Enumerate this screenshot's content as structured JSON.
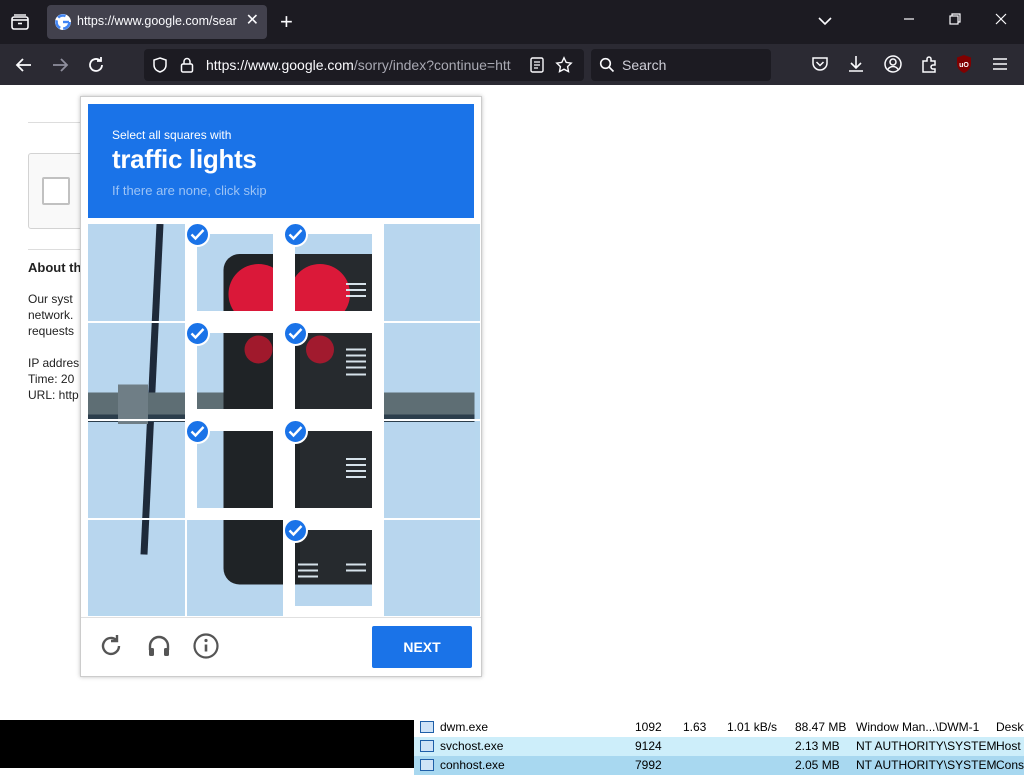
{
  "browser": {
    "tab_title": "https://www.google.com/search?",
    "url_host": "https://www.google.com",
    "url_path": "/sorry/index?continue=htt",
    "search_placeholder": "Search"
  },
  "page": {
    "about_heading": "About th",
    "para_lines": [
      "Our syst",
      "network.",
      "requests"
    ],
    "info_lines": [
      "IP addres",
      "Time: 20",
      "URL: http"
    ]
  },
  "captcha": {
    "instruction": "Select all squares with",
    "target": "traffic lights",
    "hint": "If there are none, click skip",
    "next_label": "NEXT",
    "selected_tiles": [
      1,
      2,
      5,
      6,
      9,
      10,
      14
    ],
    "icons": [
      "reload-icon",
      "audio-icon",
      "info-icon"
    ]
  },
  "taskmanager": {
    "rows": [
      {
        "name": "dwm.exe",
        "pid": "1092",
        "cpu": "1.63",
        "disk": "1.01 kB/s",
        "mem": "88.47 MB",
        "user": "Window Man...\\DWM-1",
        "desc": "Deskt"
      },
      {
        "name": "svchost.exe",
        "pid": "9124",
        "cpu": "",
        "disk": "",
        "mem": "2.13 MB",
        "user": "NT AUTHORITY\\SYSTEM",
        "desc": "Host"
      },
      {
        "name": "conhost.exe",
        "pid": "7992",
        "cpu": "",
        "disk": "",
        "mem": "2.05 MB",
        "user": "NT AUTHORITY\\SYSTEM",
        "desc": "Cons"
      }
    ]
  },
  "colors": {
    "accent": "#1a73e8",
    "tabbar_bg": "#1c1b22",
    "navbar_bg": "#2b2a33",
    "tm_row_highlight": "#cdeefa",
    "tm_row_selected": "#a8d8f0"
  }
}
